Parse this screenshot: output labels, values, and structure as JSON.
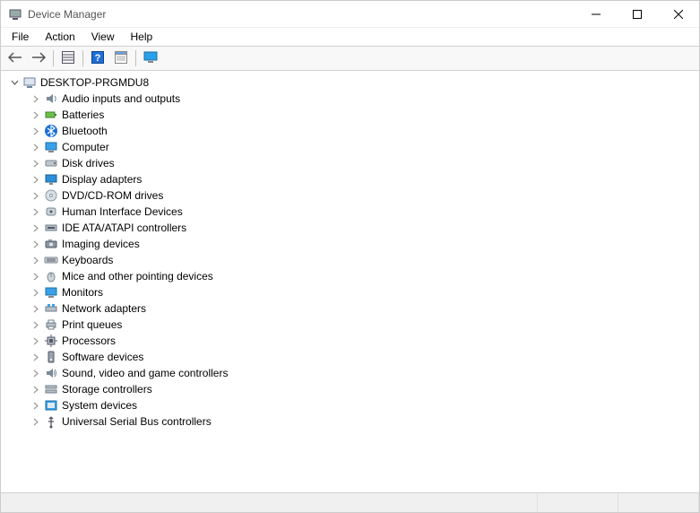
{
  "window": {
    "title": "Device Manager"
  },
  "menubar": {
    "items": [
      "File",
      "Action",
      "View",
      "Help"
    ]
  },
  "toolbar": {
    "buttons": [
      {
        "name": "back",
        "icon": "arrow-left"
      },
      {
        "name": "forward",
        "icon": "arrow-right"
      },
      {
        "name": "show-hidden",
        "icon": "grid"
      },
      {
        "name": "help",
        "icon": "help"
      },
      {
        "name": "properties",
        "icon": "props"
      },
      {
        "name": "scan",
        "icon": "monitor-scan"
      }
    ]
  },
  "tree": {
    "root": {
      "label": "DESKTOP-PRGMDU8",
      "expanded": true,
      "icon": "computer"
    },
    "categories": [
      {
        "label": "Audio inputs and outputs",
        "icon": "audio"
      },
      {
        "label": "Batteries",
        "icon": "battery"
      },
      {
        "label": "Bluetooth",
        "icon": "bluetooth"
      },
      {
        "label": "Computer",
        "icon": "monitor"
      },
      {
        "label": "Disk drives",
        "icon": "disk"
      },
      {
        "label": "Display adapters",
        "icon": "display"
      },
      {
        "label": "DVD/CD-ROM drives",
        "icon": "dvd"
      },
      {
        "label": "Human Interface Devices",
        "icon": "hid"
      },
      {
        "label": "IDE ATA/ATAPI controllers",
        "icon": "ide"
      },
      {
        "label": "Imaging devices",
        "icon": "imaging"
      },
      {
        "label": "Keyboards",
        "icon": "keyboard"
      },
      {
        "label": "Mice and other pointing devices",
        "icon": "mouse"
      },
      {
        "label": "Monitors",
        "icon": "monitor"
      },
      {
        "label": "Network adapters",
        "icon": "network"
      },
      {
        "label": "Print queues",
        "icon": "printer"
      },
      {
        "label": "Processors",
        "icon": "cpu"
      },
      {
        "label": "Software devices",
        "icon": "software"
      },
      {
        "label": "Sound, video and game controllers",
        "icon": "sound"
      },
      {
        "label": "Storage controllers",
        "icon": "storage"
      },
      {
        "label": "System devices",
        "icon": "system"
      },
      {
        "label": "Universal Serial Bus controllers",
        "icon": "usb"
      }
    ]
  }
}
